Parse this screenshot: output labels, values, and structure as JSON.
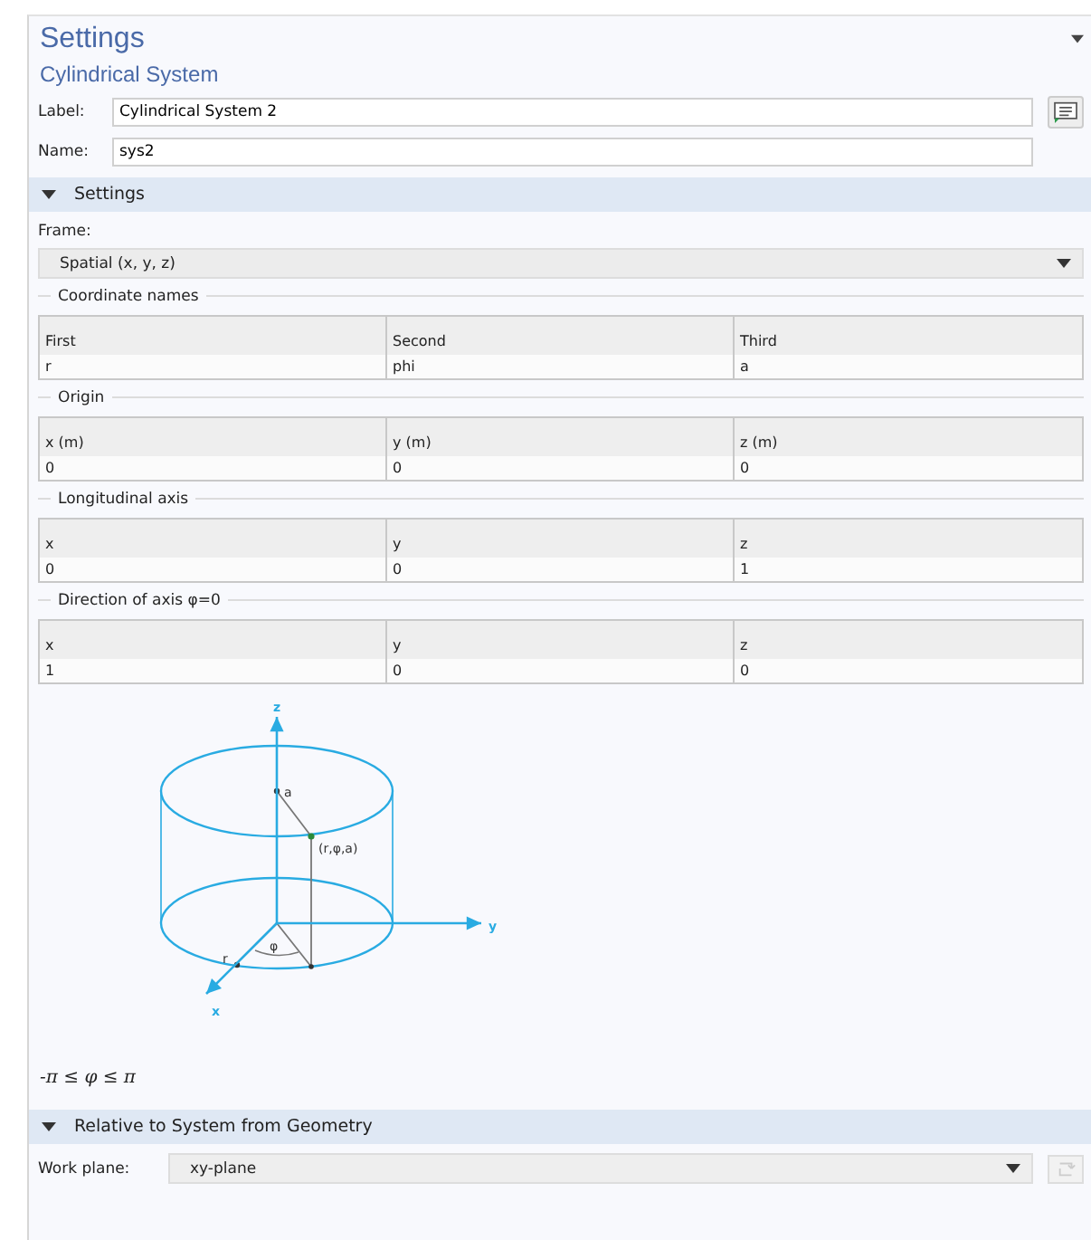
{
  "header": {
    "title": "Settings",
    "subtitle": "Cylindrical System"
  },
  "fields": [
    {
      "label": "Label:",
      "value": "Cylindrical System 2",
      "kind": "with-button"
    },
    {
      "label": "Name:",
      "value": "sys2",
      "kind": "plain"
    }
  ],
  "settings_section": {
    "title": "Settings",
    "expanded": true,
    "frame_label": "Frame:",
    "frame_value": "Spatial  (x, y, z)",
    "groups": [
      {
        "title": "Coordinate names",
        "columns": [
          "First",
          "Second",
          "Third"
        ],
        "values": [
          "r",
          "phi",
          "a"
        ]
      },
      {
        "title": "Origin",
        "columns": [
          "x (m)",
          "y (m)",
          "z (m)"
        ],
        "values": [
          "0",
          "0",
          "0"
        ]
      },
      {
        "title": "Longitudinal axis",
        "columns": [
          "x",
          "y",
          "z"
        ],
        "values": [
          "0",
          "0",
          "1"
        ]
      },
      {
        "title": "Direction of axis φ=0",
        "columns": [
          "x",
          "y",
          "z"
        ],
        "values": [
          "1",
          "0",
          "0"
        ]
      }
    ],
    "diagram_labels": [
      "z",
      "a",
      "(r,φ,a)",
      "y",
      "φ",
      "r",
      "x"
    ],
    "formula": "-π ≤ φ ≤ π"
  },
  "geometry_section": {
    "title": "Relative to System from Geometry",
    "expanded": true,
    "work_plane_label": "Work plane:",
    "work_plane_value": "xy-plane"
  }
}
